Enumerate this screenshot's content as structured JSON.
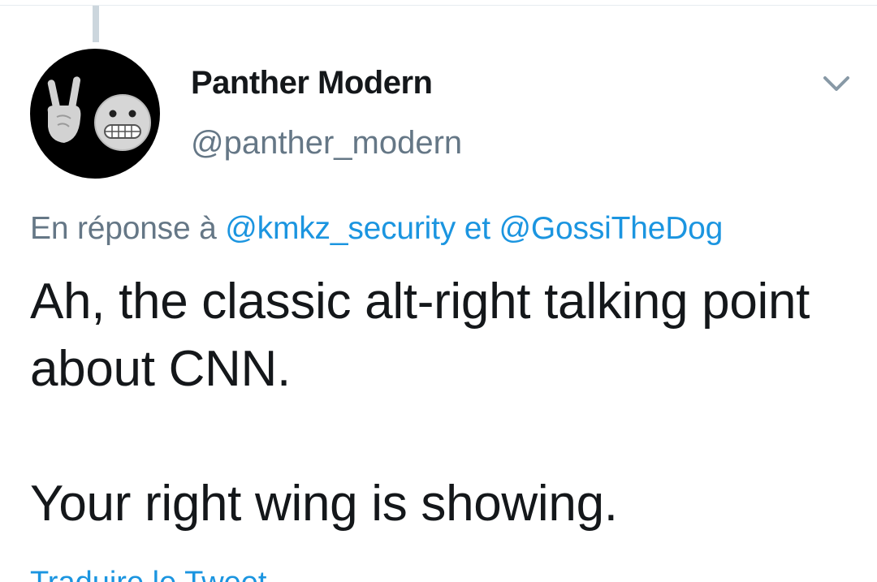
{
  "tweet": {
    "author": {
      "display_name": "Panther Modern",
      "handle": "@panther_modern",
      "avatar_icons": [
        "sign-of-the-horns-emoji",
        "grimacing-face-emoji"
      ]
    },
    "reply_context": {
      "prefix": "En réponse à",
      "mention_1": "@kmkz_security",
      "separator": "et",
      "mention_2": "@GossiTheDog"
    },
    "text": "Ah, the classic alt-right talking point about CNN.\n\nYour right wing is showing.",
    "translate_label": "Traduire le Tweet"
  },
  "colors": {
    "text_primary": "#14171a",
    "text_secondary": "#657786",
    "link": "#1b95e0",
    "thread_line": "#ccd6dd",
    "avatar_bg": "#000000"
  }
}
